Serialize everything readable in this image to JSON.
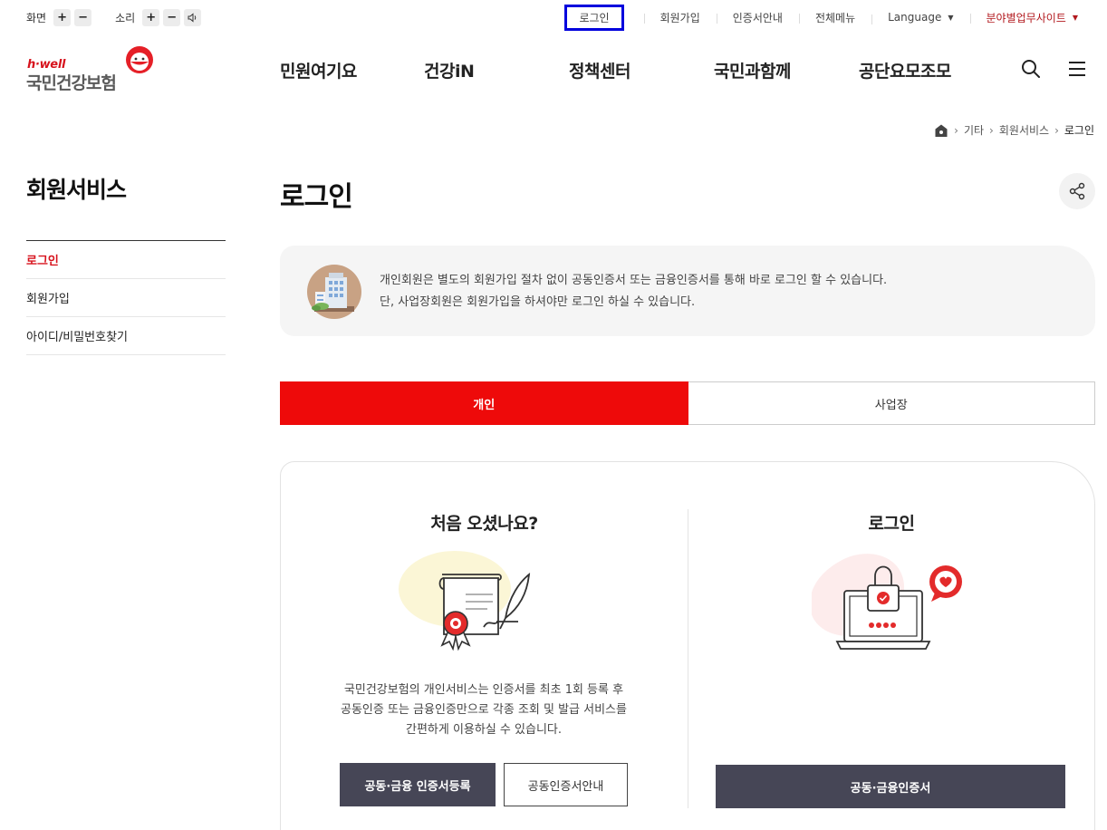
{
  "util": {
    "screen_label": "화면",
    "sound_label": "소리",
    "plus": "+",
    "minus": "−",
    "links": {
      "login": "로그인",
      "signup": "회원가입",
      "cert_guide": "인증서안내",
      "all_menu": "전체메뉴",
      "language": "Language",
      "field_sites": "분야별업무사이트"
    }
  },
  "logo": {
    "tagline": "h·well",
    "name": "국민건강보험"
  },
  "gnb": {
    "items": [
      "민원여기요",
      "건강iN",
      "정책센터",
      "국민과함께",
      "공단요모조모"
    ]
  },
  "breadcrumb": {
    "items": [
      "기타",
      "회원서비스",
      "로그인"
    ]
  },
  "lnb": {
    "title": "회원서비스",
    "items": [
      "로그인",
      "회원가입",
      "아이디/비밀번호찾기"
    ]
  },
  "page": {
    "title": "로그인"
  },
  "notice": {
    "line1": "개인회원은 별도의 회원가입 절차 없이 공동인증서 또는 금융인증서를 통해 바로 로그인 할 수 있습니다.",
    "line2": "단, 사업장회원은 회원가입을 하셔야만 로그인 하실 수 있습니다."
  },
  "tabs": {
    "personal": "개인",
    "business": "사업장"
  },
  "left_col": {
    "title": "처음 오셨나요?",
    "desc1": "국민건강보험의 개인서비스는 인증서를 최초 1회 등록 후",
    "desc2": "공동인증 또는 금융인증만으로 각종 조회 및 발급 서비스를",
    "desc3": "간편하게 이용하실 수 있습니다.",
    "register_btn": "공동·금융 인증서등록",
    "guide_btn": "공동인증서안내"
  },
  "right_col": {
    "title": "로그인",
    "login_btn": "공동·금융인증서"
  },
  "colors": {
    "accent_red": "#ee0a0a",
    "brand_red": "#d7131d",
    "dark_button": "#464656",
    "highlight_box": "#0000dd"
  }
}
